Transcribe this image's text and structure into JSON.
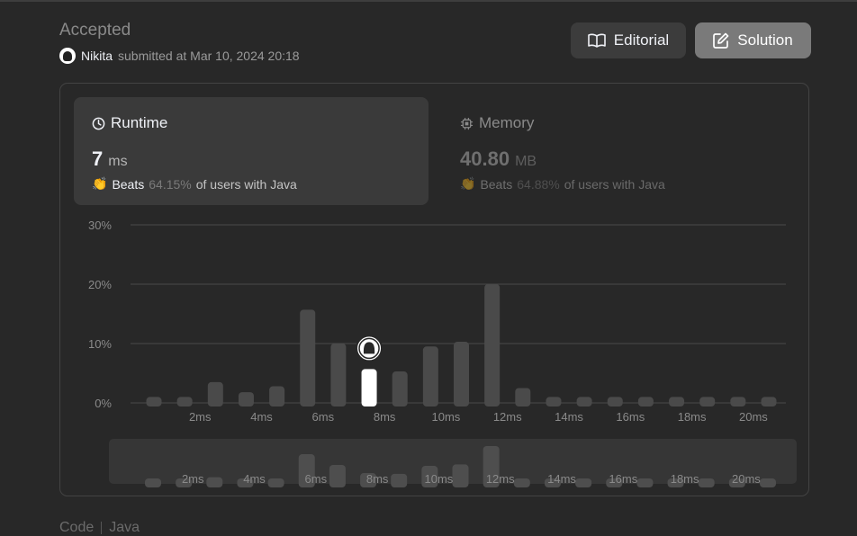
{
  "header": {
    "status": "Accepted",
    "user_name": "Nikita",
    "submitted_text": "submitted at Mar 10, 2024 20:18",
    "editorial_label": "Editorial",
    "solution_label": "Solution"
  },
  "runtime": {
    "label": "Runtime",
    "value": "7",
    "unit": "ms",
    "beats_label": "Beats",
    "beats_pct": "64.15%",
    "beats_suffix": "of users with Java"
  },
  "memory": {
    "label": "Memory",
    "value": "40.80",
    "unit": "MB",
    "beats_label": "Beats",
    "beats_pct": "64.88%",
    "beats_suffix": "of users with Java"
  },
  "colors": {
    "background": "#282828",
    "bar": "#4a4a4a",
    "highlight_bar": "#ffffff",
    "gridline": "#4a4a4a"
  },
  "chart_data": {
    "type": "bar",
    "xlabel": "",
    "ylabel": "",
    "yticks": [
      "30%",
      "20%",
      "10%",
      "0%"
    ],
    "ylim": [
      0,
      30
    ],
    "xtick_labels": [
      "2ms",
      "4ms",
      "6ms",
      "8ms",
      "10ms",
      "12ms",
      "14ms",
      "16ms",
      "18ms",
      "20ms"
    ],
    "categories": [
      0,
      1,
      2,
      3,
      4,
      5,
      6,
      7,
      8,
      9,
      10,
      11,
      12,
      13,
      14,
      15,
      16,
      17,
      18,
      19,
      20
    ],
    "values": [
      1.0,
      1.0,
      3.5,
      1.8,
      2.8,
      15.7,
      10.0,
      5.7,
      5.3,
      9.5,
      10.3,
      20.0,
      2.5,
      1.0,
      1.0,
      1.0,
      1.0,
      1.0,
      1.0,
      1.0,
      1.0
    ],
    "highlight_index": 7,
    "grid": true
  },
  "footer": {
    "code_label": "Code",
    "language": "Java"
  }
}
